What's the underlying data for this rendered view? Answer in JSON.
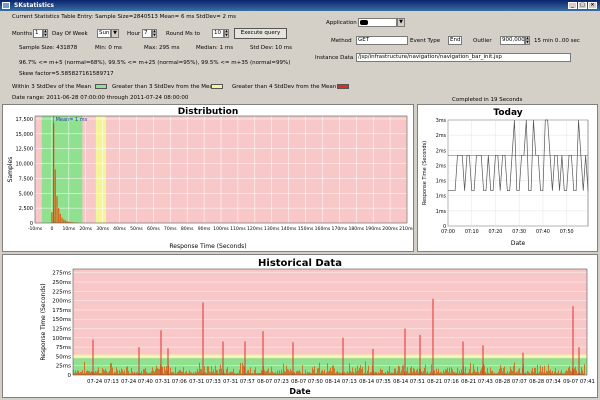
{
  "window": {
    "title": "SKstatistics",
    "controls": [
      "_",
      "□",
      "×"
    ]
  },
  "header": {
    "current_entry": "Current Statistics Table Entry: Sample Size=2840513 Mean= 6 ms StdDev= 2 ms",
    "months_label": "Months",
    "months_value": "1",
    "dow_label": "Day Of Week",
    "dow_value": "Sun",
    "hour_label": "Hour",
    "hour_value": "7",
    "round_label": "Round Ms to",
    "round_value": "10",
    "execute_label": "Execute query",
    "application_label": "Application",
    "method_label": "Method",
    "method_value": "GET",
    "event_type_label": "Event Type",
    "event_type_value": "End",
    "outlier_label": "Outlier",
    "outlier_value": "900,000",
    "outlier_unit": "15 min 0..00 sec",
    "instance_label": "Instance Data",
    "instance_value": "/jsp/infrastructure/navigation/navigation_bar_init.jsp"
  },
  "stats": {
    "sample_size": "Sample Size: 431878",
    "min": "Min: 0 ms",
    "max": "Max: 295 ms",
    "median": "Median: 1 ms",
    "stddev": "Std Dev: 10 ms",
    "line2": "96.7% <= m+5 (normal=68%), 99.5% <= m+25 (normal=95%), 99.5% <= m+35 (normal=99%)",
    "skew": "Skew factor=5.585827161589717"
  },
  "legend": {
    "within": "Within 3 StdDev of the Mean",
    "gt3": "Greater than 3 StdDev from the Mean",
    "gt4": "Greater than 4 StdDev from the Mean"
  },
  "date_range": "Date range: 2011-06-28 07:00:00 through 2011-07-24 08:00:00",
  "colors": {
    "within": "#8fe08f",
    "gt3": "#f4f49a",
    "gt4": "#e02a2a",
    "bg_red": "#f8c8c8",
    "bar": "#d46a1a",
    "red_line": "#e03030"
  },
  "chart_data": [
    {
      "type": "bar",
      "title": "Distribution",
      "xlabel": "Response Time (Seconds)",
      "ylabel": "Samples",
      "annotation": "Mean= 1 ms",
      "x_ticks": [
        "-10ms",
        "0",
        "10ms",
        "20ms",
        "30ms",
        "40ms",
        "50ms",
        "60ms",
        "70ms",
        "80ms",
        "90ms",
        "100ms",
        "110ms",
        "120ms",
        "130ms",
        "140ms",
        "150ms",
        "160ms",
        "170ms",
        "180ms",
        "190ms",
        "200ms",
        "210ms"
      ],
      "y_ticks": [
        "0",
        "2,500",
        "5,000",
        "7,500",
        "10,000",
        "12,500",
        "15,000",
        "17,500"
      ],
      "xlim": [
        -10,
        210
      ],
      "ylim": [
        0,
        18000
      ],
      "x": [
        0,
        1,
        2,
        3,
        4,
        5,
        6,
        7,
        8,
        9,
        10,
        11,
        12,
        13,
        14,
        15
      ],
      "values": [
        1800,
        16800,
        9000,
        4500,
        2500,
        1500,
        900,
        600,
        420,
        300,
        220,
        170,
        130,
        100,
        80,
        60
      ]
    },
    {
      "type": "line",
      "title": "Today",
      "subtitle": "Completed in 19 Seconds",
      "xlabel": "Date",
      "ylabel": "Response Time (Seconds)",
      "x_ticks": [
        "07:00",
        "07:10",
        "07:20",
        "07:30",
        "07:40",
        "07:50"
      ],
      "y_ticks": [
        "0",
        "1ms",
        "1ms",
        "1ms",
        "2ms",
        "2ms",
        "2ms",
        "3ms"
      ],
      "xlim": [
        0,
        59
      ],
      "ylim": [
        0,
        3
      ],
      "x": [
        0,
        1,
        2,
        3,
        4,
        5,
        6,
        7,
        8,
        9,
        10,
        11,
        12,
        13,
        14,
        15,
        16,
        17,
        18,
        19,
        20,
        21,
        22,
        23,
        24,
        25,
        26,
        27,
        28,
        29,
        30,
        31,
        32,
        33,
        34,
        35,
        36,
        37,
        38,
        39,
        40,
        41,
        42,
        43,
        44,
        45,
        46,
        47,
        48,
        49,
        50,
        51,
        52,
        53,
        54,
        55,
        56,
        57,
        58,
        59
      ],
      "values": [
        1,
        1,
        1,
        1,
        2,
        2,
        2,
        1,
        2,
        2,
        1,
        1,
        2,
        2,
        2,
        1,
        1,
        2,
        1,
        1,
        2,
        2,
        1,
        2,
        2,
        1,
        1,
        2,
        3,
        1,
        1,
        2,
        2,
        3,
        1,
        1,
        3,
        2,
        2,
        1,
        1,
        3,
        3,
        2,
        1,
        2,
        2,
        1,
        2,
        1,
        1,
        2,
        2,
        1,
        1,
        3,
        2,
        1,
        2,
        1
      ]
    },
    {
      "type": "bar",
      "title": "Historical Data",
      "xlabel": "Date",
      "ylabel": "Response Time (Seconds)",
      "x_ticks": [
        "07-24 07:13",
        "07-24 07:40",
        "07-31 07:06",
        "07-31 07:33",
        "07-31 07:57",
        "08-07 07:23",
        "08-07 07:50",
        "08-14 07:13",
        "08-14 07:35",
        "08-14 07:51",
        "08-21 07:16",
        "08-21 07:43",
        "08-28 07:07",
        "08-28 07:34",
        "09-07 07:41"
      ],
      "y_ticks": [
        "0",
        "25ms",
        "50ms",
        "75ms",
        "100ms",
        "125ms",
        "150ms",
        "175ms",
        "200ms",
        "225ms",
        "250ms",
        "275ms"
      ],
      "ylim": [
        0,
        285
      ]
    }
  ]
}
